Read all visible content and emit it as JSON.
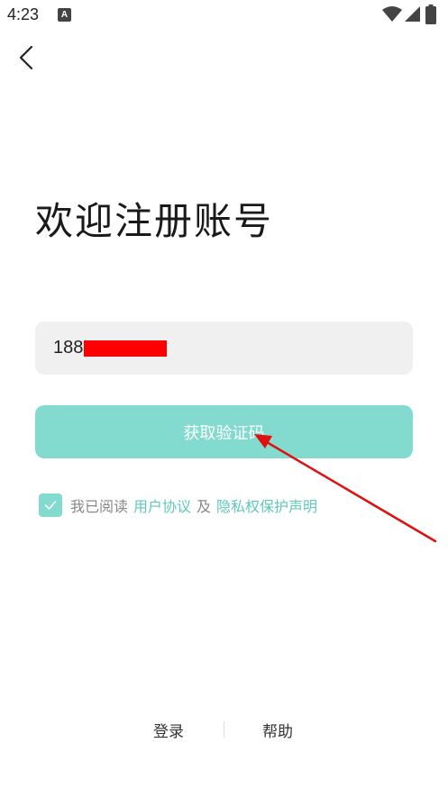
{
  "status_bar": {
    "time": "4:23",
    "notification_icon_letter": "A",
    "icons": [
      "wifi-icon",
      "signal-icon",
      "battery-icon"
    ]
  },
  "nav": {
    "back_icon": "chevron-left-icon"
  },
  "title": "欢迎注册账号",
  "phone": {
    "value": "188",
    "redacted": true
  },
  "get_code_button": "获取验证码",
  "agreement": {
    "checked": true,
    "prefix": "我已阅读",
    "user_agreement": "用户协议",
    "conjunction": "及",
    "privacy_policy": "隐私权保护声明"
  },
  "footer": {
    "login": "登录",
    "help": "帮助"
  },
  "colors": {
    "accent": "#82dbce",
    "link": "#5fc9ba",
    "field_bg": "#f0f0f0",
    "annotation": "#e01010"
  }
}
